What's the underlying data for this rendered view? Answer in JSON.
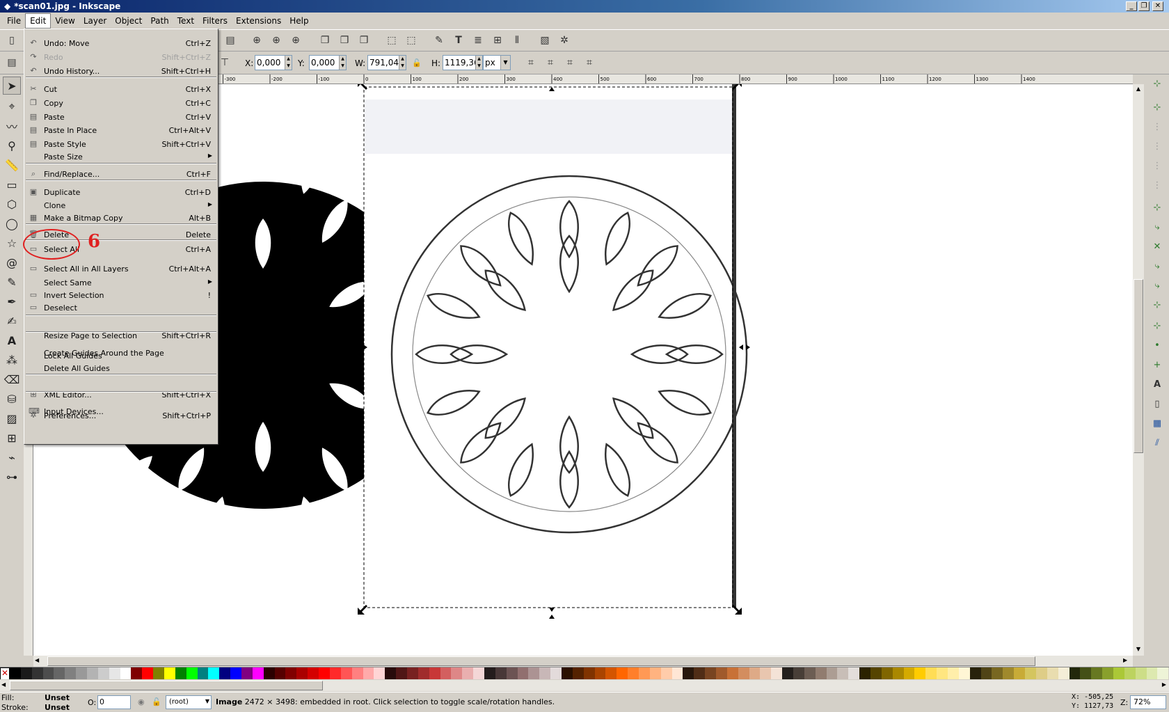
{
  "window": {
    "title": "*scan01.jpg - Inkscape",
    "controls": [
      "_",
      "❐",
      "✕"
    ]
  },
  "menubar": [
    "File",
    "Edit",
    "View",
    "Layer",
    "Object",
    "Path",
    "Text",
    "Filters",
    "Extensions",
    "Help"
  ],
  "edit_menu": [
    {
      "label": "Undo: Move",
      "shortcut": "Ctrl+Z",
      "icon": "undo-icon",
      "glyph": "↶"
    },
    {
      "label": "Redo",
      "shortcut": "Shift+Ctrl+Z",
      "icon": "redo-icon",
      "glyph": "↷",
      "disabled": true
    },
    {
      "label": "Undo History...",
      "shortcut": "Shift+Ctrl+H",
      "icon": "undo-history-icon",
      "glyph": "↶"
    },
    {
      "sep": true
    },
    {
      "label": "Cut",
      "shortcut": "Ctrl+X",
      "icon": "cut-icon",
      "glyph": "✂"
    },
    {
      "label": "Copy",
      "shortcut": "Ctrl+C",
      "icon": "copy-icon",
      "glyph": "❐"
    },
    {
      "label": "Paste",
      "shortcut": "Ctrl+V",
      "icon": "paste-icon",
      "glyph": "▤"
    },
    {
      "label": "Paste In Place",
      "shortcut": "Ctrl+Alt+V",
      "icon": "paste-in-place-icon",
      "glyph": "▤"
    },
    {
      "label": "Paste Style",
      "shortcut": "Shift+Ctrl+V",
      "icon": "paste-style-icon",
      "glyph": "▤"
    },
    {
      "label": "Paste Size",
      "shortcut": "",
      "submenu": true
    },
    {
      "sep": true
    },
    {
      "label": "Find/Replace...",
      "shortcut": "Ctrl+F",
      "icon": "find-icon",
      "glyph": "⌕"
    },
    {
      "sep": true
    },
    {
      "label": "Duplicate",
      "shortcut": "Ctrl+D",
      "icon": "duplicate-icon",
      "glyph": "▣"
    },
    {
      "label": "Clone",
      "shortcut": "",
      "submenu": true
    },
    {
      "label": "Make a Bitmap Copy",
      "shortcut": "Alt+B",
      "icon": "bitmap-copy-icon",
      "glyph": "▦"
    },
    {
      "sep": true
    },
    {
      "label": "Delete",
      "shortcut": "Delete",
      "icon": "delete-icon",
      "glyph": "🗑"
    },
    {
      "sep": true
    },
    {
      "label": "Select All",
      "shortcut": "Ctrl+A",
      "icon": "select-all-icon",
      "glyph": "▭"
    },
    {
      "label": "Select All in All Layers",
      "shortcut": "Ctrl+Alt+A",
      "icon": "select-all-layers-icon",
      "glyph": "▭"
    },
    {
      "label": "Select Same",
      "shortcut": "",
      "submenu": true
    },
    {
      "label": "Invert Selection",
      "shortcut": "!",
      "icon": "invert-selection-icon",
      "glyph": "▭"
    },
    {
      "label": "Deselect",
      "shortcut": "",
      "icon": "deselect-icon",
      "glyph": "▭"
    },
    {
      "sep": true
    },
    {
      "label": "Resize Page to Selection",
      "shortcut": "Shift+Ctrl+R"
    },
    {
      "sep": true
    },
    {
      "label": "Create Guides Around the Page",
      "shortcut": ""
    },
    {
      "label": "Lock All Guides",
      "shortcut": ""
    },
    {
      "label": "Delete All Guides",
      "shortcut": ""
    },
    {
      "sep": true
    },
    {
      "label": "XML Editor...",
      "shortcut": "Shift+Ctrl+X",
      "icon": "xml-editor-icon",
      "glyph": "⊞"
    },
    {
      "sep": true
    },
    {
      "label": "Input Devices...",
      "shortcut": "",
      "icon": "input-devices-icon",
      "glyph": "⌨"
    },
    {
      "label": "Preferences...",
      "shortcut": "Shift+Ctrl+P",
      "icon": "preferences-icon",
      "glyph": "✲"
    }
  ],
  "annotation": {
    "step": "6",
    "color": "#e02020"
  },
  "controls": {
    "x_label": "X:",
    "x_value": "0,000",
    "y_label": "Y:",
    "y_value": "0,000",
    "w_label": "W:",
    "w_value": "791,040",
    "h_label": "H:",
    "h_value": "1119,36",
    "unit": "px"
  },
  "ruler_labels": [
    "-300",
    "-200",
    "-100",
    "0",
    "100",
    "200",
    "300",
    "400",
    "500",
    "600",
    "700",
    "800",
    "900",
    "1000",
    "1100",
    "1200",
    "1300",
    "1400"
  ],
  "status": {
    "fill_label": "Fill:",
    "fill_value": "Unset",
    "stroke_label": "Stroke:",
    "stroke_value": "Unset",
    "opacity_label": "O:",
    "opacity_value": "0",
    "layer": "(root)",
    "message_bold": "Image",
    "message": " 2472 × 3498: embedded in root. Click selection to toggle scale/rotation handles.",
    "cursor_x": "X: -505,25",
    "cursor_y": "Y: 1127,73",
    "zoom_label": "Z:",
    "zoom_value": "72%"
  },
  "palette": [
    "#000000",
    "#1a1a1a",
    "#333333",
    "#4d4d4d",
    "#666666",
    "#808080",
    "#999999",
    "#b3b3b3",
    "#cccccc",
    "#e6e6e6",
    "#ffffff",
    "#800000",
    "#ff0000",
    "#808000",
    "#ffff00",
    "#008000",
    "#00ff00",
    "#008080",
    "#00ffff",
    "#000080",
    "#0000ff",
    "#800080",
    "#ff00ff",
    "#2b0000",
    "#550000",
    "#800000",
    "#aa0000",
    "#d40000",
    "#ff0000",
    "#ff2a2a",
    "#ff5555",
    "#ff8080",
    "#ffaaaa",
    "#ffd5d5",
    "#280b0b",
    "#501616",
    "#782121",
    "#a02c2c",
    "#c83737",
    "#d35f5f",
    "#de8787",
    "#e9afaf",
    "#f4d7d7",
    "#241c1c",
    "#483737",
    "#6c5353",
    "#916f6f",
    "#ac9393",
    "#c8b7b7",
    "#e3dbdb",
    "#2b1100",
    "#552200",
    "#803300",
    "#aa4400",
    "#d45500",
    "#ff6600",
    "#ff7f2a",
    "#ff9955",
    "#ffb380",
    "#ffccaa",
    "#ffe6d5",
    "#28170b",
    "#502d16",
    "#784421",
    "#a05a2c",
    "#c87137",
    "#d38d5f",
    "#deaa87",
    "#e9c6af",
    "#f4e3d7",
    "#241f1c",
    "#483e37",
    "#6c5d53",
    "#917c6f",
    "#ac9d93",
    "#c8beb7",
    "#e3dedb",
    "#2b2200",
    "#554400",
    "#806600",
    "#aa8800",
    "#d4aa00",
    "#ffcc00",
    "#ffdd55",
    "#ffe680",
    "#ffeeaa",
    "#fff6d5",
    "#28220b",
    "#504416",
    "#786721",
    "#a0892c",
    "#c8ab37",
    "#d4c55f",
    "#decd87",
    "#e9ddaf",
    "#f4eed7",
    "#22280b",
    "#445016",
    "#677821",
    "#89a02c",
    "#abc837",
    "#bcd35f",
    "#cdde87",
    "#dde9af",
    "#eef4d7"
  ]
}
